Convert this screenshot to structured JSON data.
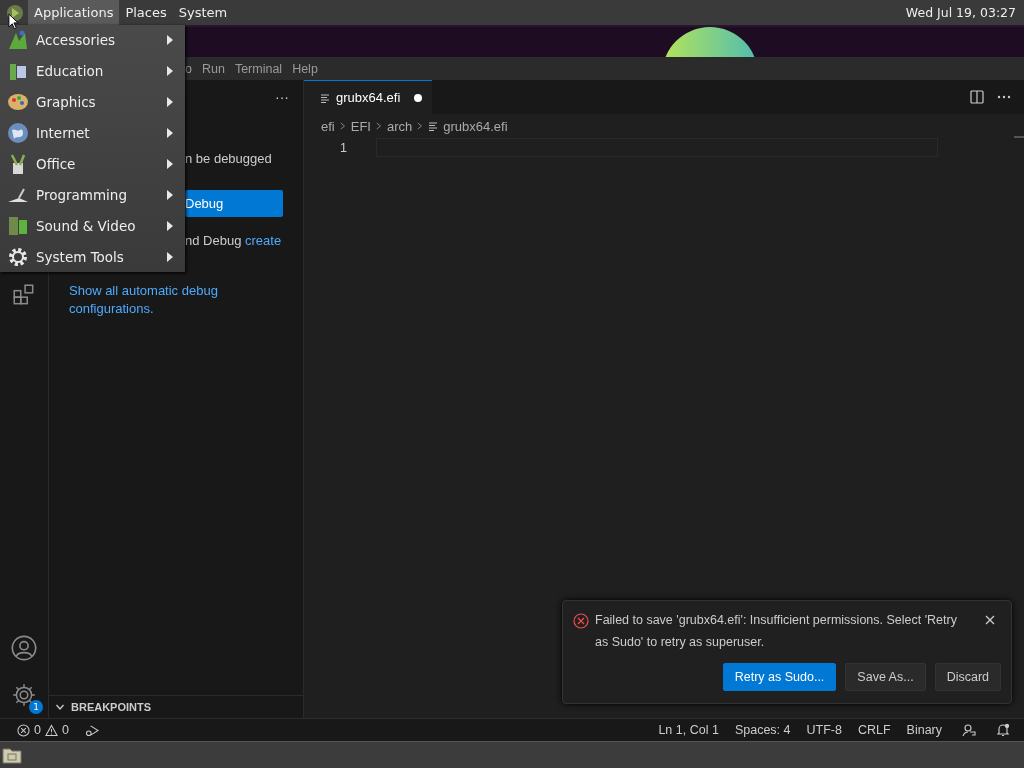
{
  "top_panel": {
    "menus": [
      {
        "label": "Applications",
        "selected": true
      },
      {
        "label": "Places",
        "selected": false
      },
      {
        "label": "System",
        "selected": false
      }
    ],
    "clock": "Wed Jul 19, 03:27"
  },
  "app_menu": {
    "items": [
      {
        "label": "Accessories"
      },
      {
        "label": "Education"
      },
      {
        "label": "Graphics"
      },
      {
        "label": "Internet"
      },
      {
        "label": "Office"
      },
      {
        "label": "Programming"
      },
      {
        "label": "Sound & Video"
      },
      {
        "label": "System Tools"
      }
    ]
  },
  "editor_menu": [
    "o",
    "Run",
    "Terminal",
    "Help"
  ],
  "activity_bar": {
    "settings_badge": "1"
  },
  "sidebar": {
    "more": "···",
    "debug_text": "n be debugged",
    "debug_button": "Debug",
    "launch_text": "nd Debug ",
    "launch_link": "create",
    "configs_link": "Show all automatic debug configurations.",
    "breakpoints": {
      "label": "BREAKPOINTS",
      "expanded": true
    }
  },
  "editor": {
    "tabs": [
      {
        "label": "grubx64.efi",
        "selected": true,
        "modified": true
      }
    ],
    "breadcrumbs": [
      "efi",
      "EFI",
      "arch",
      "grubx64.efi"
    ],
    "line_numbers": [
      "1"
    ]
  },
  "notification": {
    "message": "Failed to save 'grubx64.efi': Insufficient permissions. Select 'Retry as Sudo' to retry as superuser.",
    "buttons": [
      {
        "label": "Retry as Sudo...",
        "primary": true
      },
      {
        "label": "Save As...",
        "primary": false
      },
      {
        "label": "Discard",
        "primary": false
      }
    ]
  },
  "status_bar": {
    "errors": "0",
    "warnings": "0",
    "items": [
      "Ln 1, Col 1",
      "Spaces: 4",
      "UTF-8",
      "CRLF",
      "Binary"
    ]
  }
}
